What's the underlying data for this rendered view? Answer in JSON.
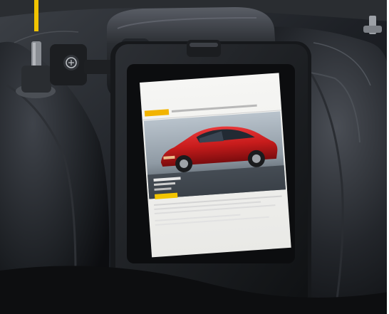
{
  "accent_color": "#f2c400",
  "screen": {
    "header_tag_color": "#f2b400",
    "button_color": "#f2c400"
  },
  "car_color": "#c81c1c"
}
